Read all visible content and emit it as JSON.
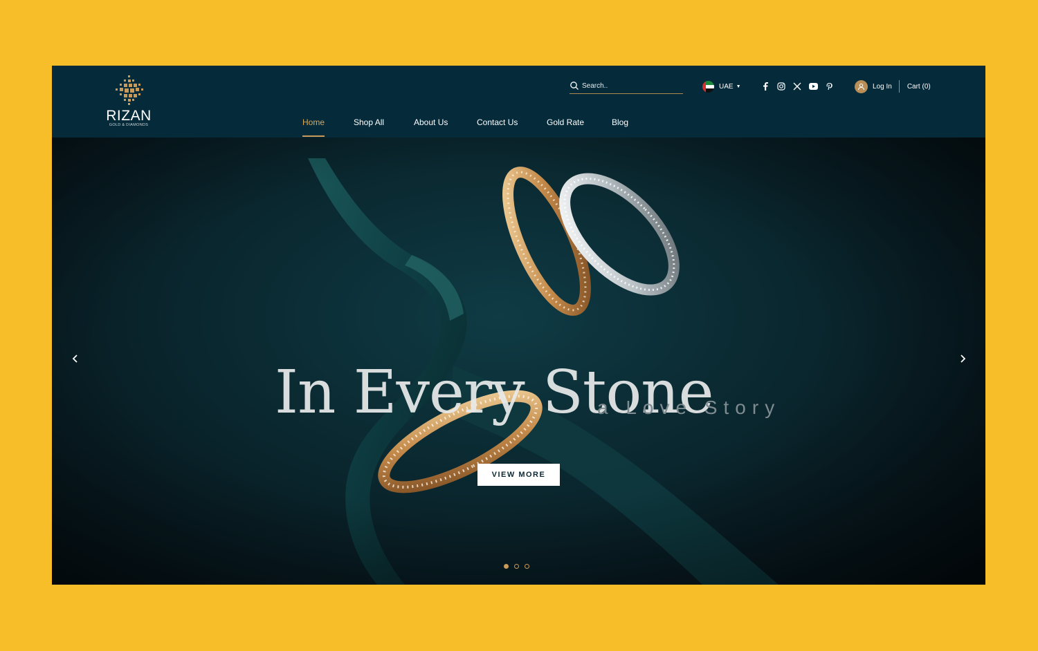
{
  "brand": {
    "name": "RIZAN",
    "tagline": "GOLD & DIAMONDS"
  },
  "search": {
    "placeholder": "Search.."
  },
  "country": {
    "label": "UAE",
    "flag_icon": "uae-flag-icon"
  },
  "socials": [
    "facebook-icon",
    "instagram-icon",
    "x-icon",
    "youtube-icon",
    "pinterest-icon"
  ],
  "account": {
    "login_label": "Log In",
    "cart_label": "Cart (0)"
  },
  "nav": {
    "items": [
      {
        "label": "Home",
        "active": true
      },
      {
        "label": "Shop All"
      },
      {
        "label": "About Us"
      },
      {
        "label": "Contact Us"
      },
      {
        "label": "Gold Rate"
      },
      {
        "label": "Blog"
      }
    ]
  },
  "hero": {
    "headline": "In Every Stone",
    "subline": "a Love Story",
    "cta_label": "VIEW MORE",
    "slides_count": 3,
    "active_slide": 1
  },
  "colors": {
    "page_bg": "#F8BE2A",
    "header_bg": "#052B3B",
    "accent_gold": "#C99A58",
    "hero_bg": "#0B2B33"
  }
}
